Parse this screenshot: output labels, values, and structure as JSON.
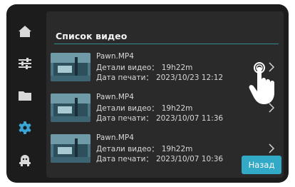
{
  "sidebar": {
    "items": [
      {
        "icon": "home-icon",
        "active": false
      },
      {
        "icon": "sliders-icon",
        "active": false
      },
      {
        "icon": "folder-icon",
        "active": false
      },
      {
        "icon": "gear-icon",
        "active": true
      },
      {
        "icon": "robot-icon",
        "active": false
      }
    ],
    "inactive_color": "#d9d9d9",
    "active_color": "#3aa6d8"
  },
  "panel": {
    "title": "Список видео",
    "accent_color": "#2f8e8e"
  },
  "videos": [
    {
      "name": "Pawn.MP4",
      "detail_label": "Детали видео：",
      "detail_value": "19h22m",
      "date_label": "Дата печати：",
      "date_value": "2023/10/23 12:12"
    },
    {
      "name": "Pawn.MP4",
      "detail_label": "Детали видео：",
      "detail_value": "19h22m",
      "date_label": "Дата печати：",
      "date_value": "2023/10/07 11:36"
    },
    {
      "name": "Pawn.MP4",
      "detail_label": "Детали видео：",
      "detail_value": "19h22m",
      "date_label": "Дата печати：",
      "date_value": "2023/10/07 10:36"
    }
  ],
  "back_button": {
    "label": "Назад",
    "color": "#32a9c6"
  },
  "overlay": {
    "icon": "tap-hand-icon"
  }
}
